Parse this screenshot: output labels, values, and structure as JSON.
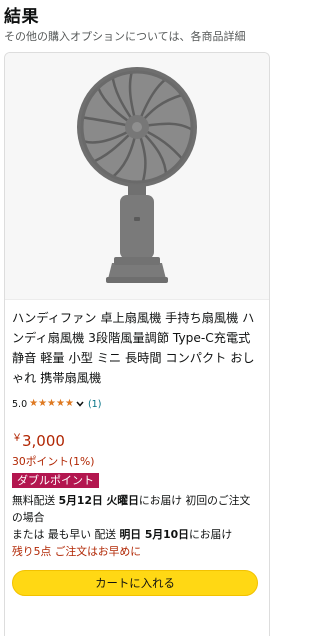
{
  "header": {
    "title": "結果",
    "subtitle": "その他の購入オプションについては、各商品詳細"
  },
  "product": {
    "image_alt": "handheld-fan-image",
    "title": "ハンディファン 卓上扇風機 手持ち扇風機 ハンディ扇風機 3段階風量調節 Type-C充電式 静音 軽量 小型 ミニ 長時間 コンパクト おしゃれ 携帯扇風機",
    "rating_value": "5.0",
    "rating_stars": 5,
    "review_count": "(1)",
    "price_symbol": "￥",
    "price": "3,000",
    "points": "30ポイント(1%)",
    "badge": "ダブルポイント",
    "delivery_line1_prefix": "無料配送 ",
    "delivery_line1_date": "5月12日 火曜日",
    "delivery_line1_suffix": "にお届け 初回のご注文の場合",
    "delivery_line2_prefix": "または 最も早い 配送 ",
    "delivery_line2_date": "明日 5月10日",
    "delivery_line2_suffix": "にお届け",
    "stock_note": "残り5点 ご注文はお早めに",
    "cart_button": "カートに入れる"
  },
  "colors": {
    "price": "#b12704",
    "badge": "#b3164f",
    "star": "#de7921",
    "button": "#ffd814",
    "link": "#007185"
  }
}
